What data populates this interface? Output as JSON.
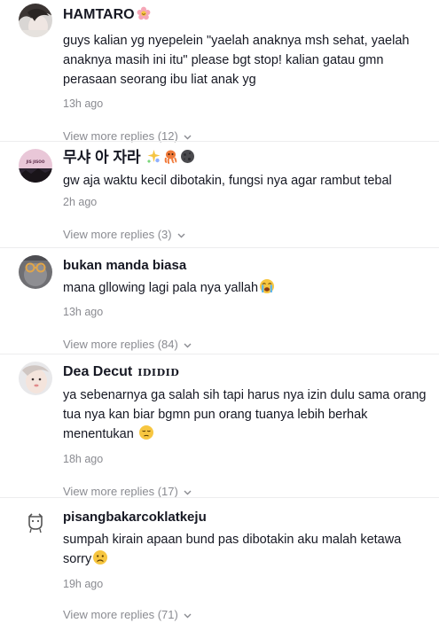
{
  "comments": [
    {
      "username": "HAMTARO",
      "text": "guys kalian yg nyepelein \"yaelah anaknya msh sehat, yaelah anaknya masih ini itu\" please bgt stop! kalian gatau gmn perasaan seorang ibu liat anak yg",
      "time": "13h ago",
      "replies": "View more replies (12)",
      "badge_icon": "flower-icon"
    },
    {
      "username": "무샤 아 자라",
      "avatar_text": "JIS JISOO",
      "text": "gw aja waktu kecil dibotakin, fungsi nya agar rambut tebal",
      "time": "2h ago",
      "replies": "View more replies (3)",
      "badge_icons": [
        "sparkle-cat-icon",
        "octopus-icon",
        "new-moon-face-icon"
      ]
    },
    {
      "username": "bukan manda biasa",
      "text": "mana gllowing lagi pala nya yallah",
      "time": "13h ago",
      "replies": "View more replies (84)",
      "emoji": "loudly-crying-face-icon"
    },
    {
      "username": "Dea Decut",
      "username_suffix": "IDIDID",
      "text": "ya sebenarnya ga salah sih tapi harus nya izin dulu sama orang tua nya kan biar bgmn pun orang tuanya lebih berhak menentukan",
      "time": "18h ago",
      "replies": "View more replies (17)",
      "emoji": "pensive-face-icon"
    },
    {
      "username": "pisangbakarcoklatkeju",
      "text": "sumpah kirain apaan bund pas dibotakin aku malah ketawa sorry",
      "time": "19h ago",
      "replies": "View more replies (71)",
      "emoji": "worried-face-icon"
    }
  ],
  "colors": {
    "text": "#161823",
    "muted": "#8a8b91",
    "divider": "#ededee"
  }
}
